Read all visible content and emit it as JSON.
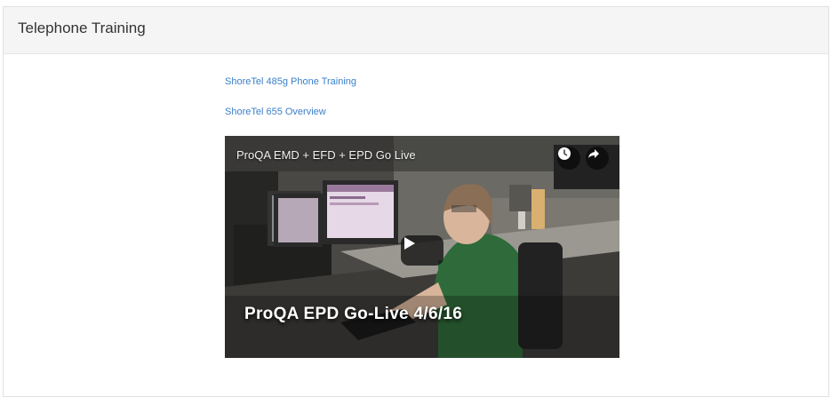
{
  "panel": {
    "title": "Telephone Training"
  },
  "links": [
    {
      "label": "ShoreTel 485g Phone Training"
    },
    {
      "label": "ShoreTel 655 Overview"
    }
  ],
  "video": {
    "title": "ProQA EMD + EFD + EPD Go Live",
    "caption": "ProQA EPD Go-Live 4/6/16",
    "icons": {
      "watch_later": "clock-icon",
      "share": "share-icon",
      "play": "play-icon"
    }
  }
}
